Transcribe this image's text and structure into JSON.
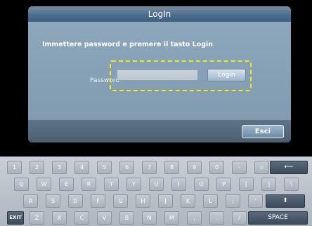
{
  "dialog": {
    "title": "LogIn",
    "instruction": "Immettere password  e premere il tasto Login",
    "password_label": "Password",
    "password_value": "",
    "login_label": "Login",
    "exit_label": "Esci",
    "focus_color": "#f0ea1c"
  },
  "keyboard": {
    "row1": [
      "1",
      "2",
      "3",
      "4",
      "5",
      "6",
      "7",
      "8",
      "9",
      "0",
      "-",
      "="
    ],
    "backspace": "⟵",
    "row2": [
      "Q",
      "W",
      "E",
      "R",
      "T",
      "Y",
      "U",
      "I",
      "O",
      "P",
      "[",
      "]",
      "\\"
    ],
    "row3": [
      "A",
      "S",
      "D",
      "F",
      "G",
      "H",
      "J",
      "K",
      "L",
      ";",
      "'"
    ],
    "shift": "⬆",
    "exit": "EXIT",
    "row4": [
      "Z",
      "X",
      "C",
      "V",
      "B",
      "N",
      "M",
      ",",
      ".",
      "/"
    ],
    "space": "SPACE"
  }
}
